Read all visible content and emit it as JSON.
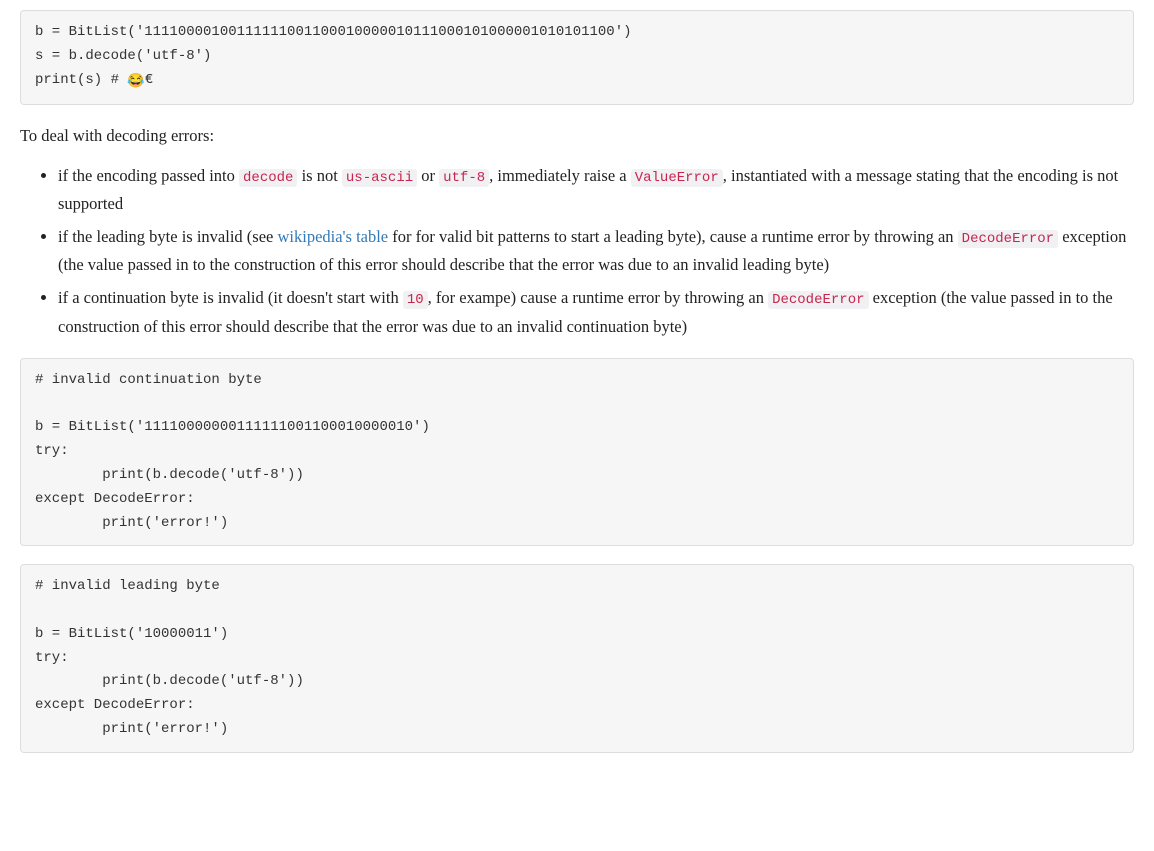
{
  "code_block_1": {
    "line1_prefix": "b = BitList('",
    "line1_bits": "11110000100111111001100010000010111000101000001010101100",
    "line1_suffix": "')",
    "line2": "s = b.decode('utf-8')",
    "line3_prefix": "print(s) # ",
    "line3_emoji": "😂",
    "line3_suffix": "€"
  },
  "para_intro": "To deal with decoding errors:",
  "bullet1": {
    "t1": "if the encoding passed into ",
    "c1": "decode",
    "t2": " is not ",
    "c2": "us-ascii",
    "t3": " or ",
    "c3": "utf-8",
    "t4": ", immediately raise a ",
    "c4": "ValueError",
    "t5": ", instantiated with a message stating that the encoding is not supported"
  },
  "bullet2": {
    "t1": "if the leading byte is invalid (see ",
    "link_text": "wikipedia's table",
    "t2": " for for valid bit patterns to start a leading byte), cause a runtime error by throwing an ",
    "c1": "DecodeError",
    "t3": " exception (the value passed in to the construction of this error should describe that the error was due to an invalid leading byte)"
  },
  "bullet3": {
    "t1": "if a continuation byte is invalid (it doesn't start with ",
    "c1": "10",
    "t2": ", for exampe) cause a runtime error by throwing an ",
    "c2": "DecodeError",
    "t3": " exception (the value passed in to the construction of this error should describe that the error was due to an invalid continuation byte)"
  },
  "code_block_2": {
    "line1": "# invalid continuation byte",
    "line2": "",
    "line3": "b = BitList('11110000000111111001100010000010')",
    "line4": "try:",
    "line5": "        print(b.decode('utf-8'))",
    "line6": "except DecodeError:",
    "line7": "        print('error!')"
  },
  "code_block_3": {
    "line1": "# invalid leading byte",
    "line2": "",
    "line3": "b = BitList('10000011')",
    "line4": "try:",
    "line5": "        print(b.decode('utf-8'))",
    "line6": "except DecodeError:",
    "line7": "        print('error!')"
  }
}
